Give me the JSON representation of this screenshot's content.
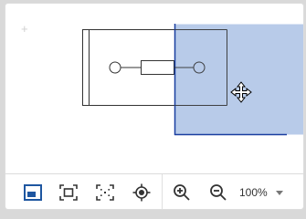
{
  "canvas": {
    "add_glyph": "+"
  },
  "toolbar": {
    "buttons": [
      {
        "name": "minimap-toggle-button",
        "icon": "panel-icon"
      },
      {
        "name": "fit-to-screen-button",
        "icon": "fit-frame-icon"
      },
      {
        "name": "full-page-button",
        "icon": "dashed-frame-icon"
      },
      {
        "name": "center-view-button",
        "icon": "target-icon"
      },
      {
        "name": "zoom-in-button",
        "icon": "zoom-in-icon"
      },
      {
        "name": "zoom-out-button",
        "icon": "zoom-out-icon"
      }
    ],
    "zoom": {
      "value": "100%"
    }
  },
  "colors": {
    "accent": "#1e56a0",
    "viewport_fill": "#b4c8e8",
    "viewport_stroke": "#1a3ea0",
    "diagram_stroke": "#333333"
  }
}
